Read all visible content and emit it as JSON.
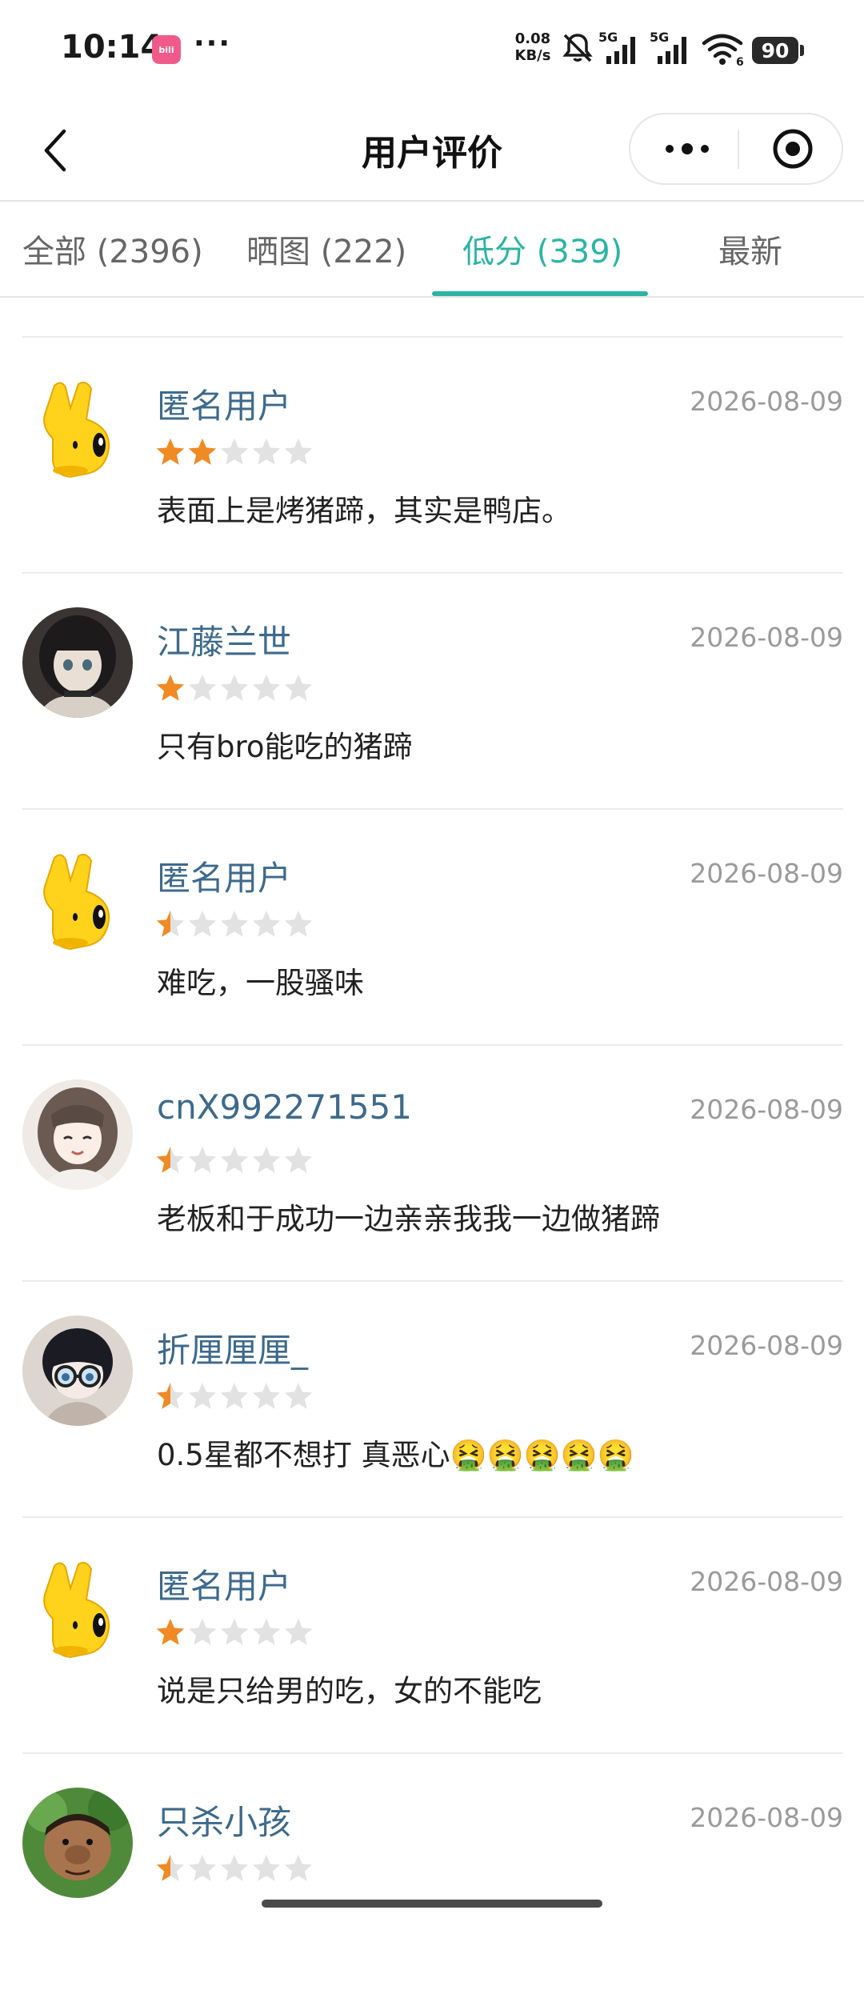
{
  "status_bar": {
    "time": "10:14",
    "app_badge": "bili",
    "more": "···",
    "net_speed_value": "0.08",
    "net_speed_unit": "KB/s",
    "net1_label": "5G",
    "net2_label": "5G",
    "wifi_sub": "6",
    "battery": "90",
    "icons": [
      "mute-bell-icon",
      "signal-icon",
      "signal-icon",
      "wifi-icon",
      "battery-icon"
    ]
  },
  "header": {
    "title": "用户评价",
    "back_icon": "chevron-left-icon",
    "more_icon": "ellipsis-icon",
    "close_icon": "target-icon"
  },
  "tabs": [
    {
      "label": "全部 (2396)",
      "active": false
    },
    {
      "label": "晒图 (222)",
      "active": false
    },
    {
      "label": "低分 (339)",
      "active": true
    },
    {
      "label": "最新",
      "active": false
    }
  ],
  "colors": {
    "accent": "#2bb5a3",
    "username": "#3d6a8c",
    "star_filled": "#f08a24",
    "star_empty": "#e2e2e2"
  },
  "reviews": [
    {
      "user": "匿名用户",
      "date": "2026-08-09",
      "rating": 2,
      "text": "表面上是烤猪蹄，其实是鸭店。",
      "avatar": "yellow-mascot"
    },
    {
      "user": "江藤兰世",
      "date": "2026-08-09",
      "rating": 1,
      "text": "只有bro能吃的猪蹄",
      "avatar": "doll-portrait"
    },
    {
      "user": "匿名用户",
      "date": "2026-08-09",
      "rating": 0.5,
      "text": "难吃，一股骚味",
      "avatar": "yellow-mascot"
    },
    {
      "user": "cnX992271551",
      "date": "2026-08-09",
      "rating": 0.5,
      "text": "老板和于成功一边亲亲我我一边做猪蹄",
      "avatar": "anime-girl"
    },
    {
      "user": "折厘厘厘_",
      "date": "2026-08-09",
      "rating": 0.5,
      "text": "0.5星都不想打 真恶心🤮🤮🤮🤮🤮",
      "avatar": "glasses-boy"
    },
    {
      "user": "匿名用户",
      "date": "2026-08-09",
      "rating": 1,
      "text": "说是只给男的吃，女的不能吃",
      "avatar": "yellow-mascot"
    },
    {
      "user": "只杀小孩",
      "date": "2026-08-09",
      "rating": 0.5,
      "text": "",
      "avatar": "cartoon-kid"
    }
  ]
}
